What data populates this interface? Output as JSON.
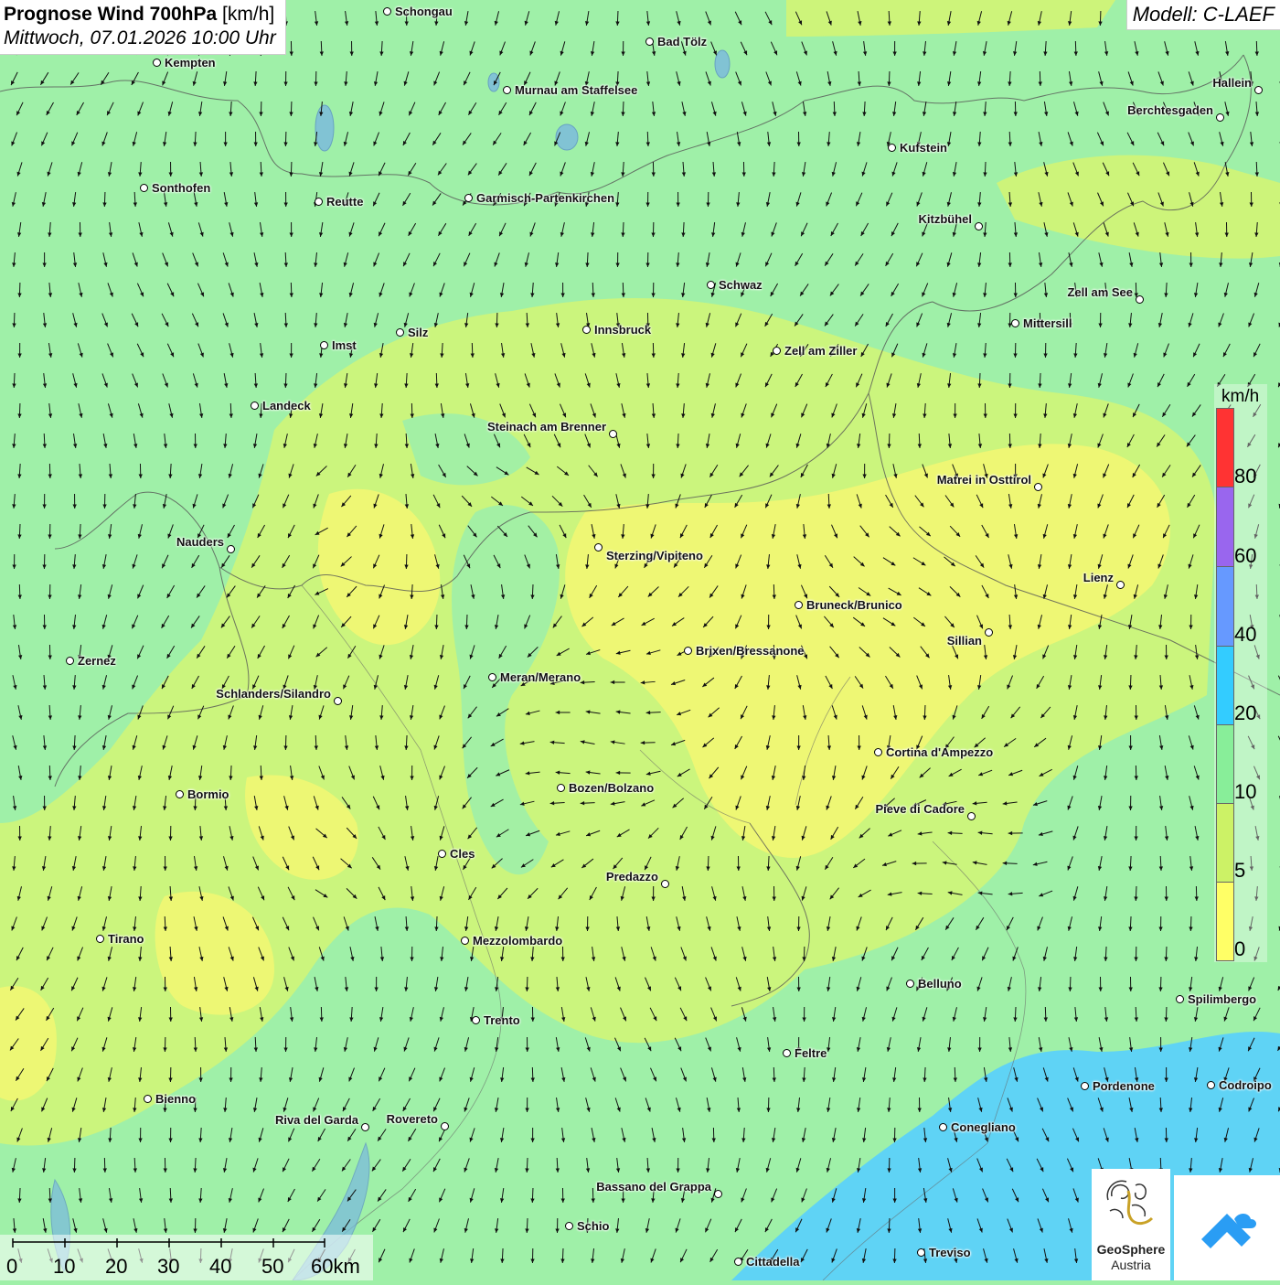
{
  "title": {
    "main": "Prognose Wind 700hPa",
    "unit": "[km/h]",
    "datetime": "Mittwoch, 07.01.2026 10:00 Uhr"
  },
  "model": "Modell: C-LAEF",
  "legend": {
    "unit": "km/h",
    "labels": [
      "80",
      "60",
      "40",
      "20",
      "10",
      "5",
      "0"
    ],
    "colors": [
      "#ff3333",
      "#9966ee",
      "#6699ff",
      "#33ccff",
      "#88ee99",
      "#ccf266",
      "#ffff66"
    ]
  },
  "scale": {
    "labels": [
      "0",
      "10",
      "20",
      "30",
      "40",
      "50",
      "60km"
    ]
  },
  "logo": {
    "line1": "GeoSphere",
    "line2": "Austria"
  },
  "cities": [
    {
      "name": "Schongau"
    },
    {
      "name": "Bad Tölz"
    },
    {
      "name": "Kempten"
    },
    {
      "name": "Murnau am Staffelsee"
    },
    {
      "name": "Hallein"
    },
    {
      "name": "Berchtesgaden"
    },
    {
      "name": "Kufstein"
    },
    {
      "name": "Sonthofen"
    },
    {
      "name": "Reutte"
    },
    {
      "name": "Garmisch-Partenkirchen"
    },
    {
      "name": "Kitzbühel"
    },
    {
      "name": "Schwaz"
    },
    {
      "name": "Zell am See"
    },
    {
      "name": "Mittersill"
    },
    {
      "name": "Imst"
    },
    {
      "name": "Silz"
    },
    {
      "name": "Innsbruck"
    },
    {
      "name": "Zell am Ziller"
    },
    {
      "name": "Landeck"
    },
    {
      "name": "Steinach am Brenner"
    },
    {
      "name": "Matrei in Osttirol"
    },
    {
      "name": "Nauders"
    },
    {
      "name": "Sterzing/Vipiteno"
    },
    {
      "name": "Lienz"
    },
    {
      "name": "Bruneck/Brunico"
    },
    {
      "name": "Sillian"
    },
    {
      "name": "Zernez"
    },
    {
      "name": "Brixen/Bressanone"
    },
    {
      "name": "Meran/Merano"
    },
    {
      "name": "Schlanders/Silandro"
    },
    {
      "name": "Cortina d'Ampezzo"
    },
    {
      "name": "Bormio"
    },
    {
      "name": "Bozen/Bolzano"
    },
    {
      "name": "Pieve di Cadore"
    },
    {
      "name": "Cles"
    },
    {
      "name": "Predazzo"
    },
    {
      "name": "Tirano"
    },
    {
      "name": "Mezzolombardo"
    },
    {
      "name": "Belluno"
    },
    {
      "name": "Spilimbergo"
    },
    {
      "name": "Trento"
    },
    {
      "name": "Feltre"
    },
    {
      "name": "Pordenone"
    },
    {
      "name": "Codroipo"
    },
    {
      "name": "Bienno"
    },
    {
      "name": "Riva del Garda"
    },
    {
      "name": "Rovereto"
    },
    {
      "name": "Conegliano"
    },
    {
      "name": "Bassano del Grappa"
    },
    {
      "name": "Schio"
    },
    {
      "name": "Treviso"
    },
    {
      "name": "Cittadella"
    }
  ]
}
